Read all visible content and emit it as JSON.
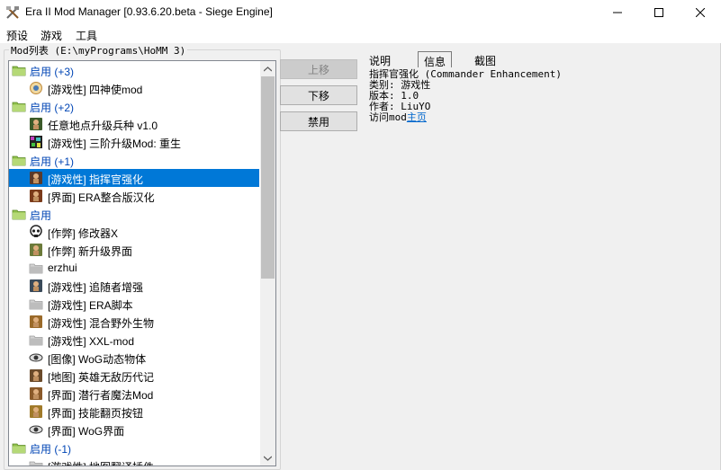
{
  "window": {
    "title": "Era II Mod Manager [0.93.6.20.beta - Siege Engine]"
  },
  "menu": {
    "items": [
      "预设",
      "游戏",
      "工具"
    ]
  },
  "modlist": {
    "label": "Mod列表 (E:\\myPrograms\\HoMM 3)",
    "rows": [
      {
        "type": "group",
        "text": "启用 (+3)",
        "icon": "folder-icon"
      },
      {
        "type": "item",
        "text": "[游戏性] 四神使mod",
        "icon": "globe-icon",
        "iconColor": "#c08a3a"
      },
      {
        "type": "group",
        "text": "启用 (+2)",
        "icon": "folder-icon"
      },
      {
        "type": "item",
        "text": "任意地点升级兵种 v1.0",
        "icon": "creature-icon",
        "iconColor": "#3b5a2a"
      },
      {
        "type": "item",
        "text": "[游戏性] 三阶升级Mod: 重生",
        "icon": "pixel-icon",
        "iconColor": "#8a3a8a"
      },
      {
        "type": "group",
        "text": "启用 (+1)",
        "icon": "folder-icon"
      },
      {
        "type": "item",
        "text": "[游戏性] 指挥官强化",
        "icon": "commander-icon",
        "iconColor": "#5a3a2a",
        "selected": true
      },
      {
        "type": "item",
        "text": "[界面] ERA整合版汉化",
        "icon": "portrait-icon",
        "iconColor": "#7a3a1a"
      },
      {
        "type": "group",
        "text": "启用",
        "icon": "folder-icon"
      },
      {
        "type": "item",
        "text": "[作弊] 修改器X",
        "icon": "skull-icon",
        "iconColor": "#222222"
      },
      {
        "type": "item",
        "text": "[作弊] 新升级界面",
        "icon": "map-icon",
        "iconColor": "#6b7a3a"
      },
      {
        "type": "item",
        "text": "erzhui",
        "icon": "blank-folder-icon",
        "iconColor": "#bdbdbd"
      },
      {
        "type": "item",
        "text": "[游戏性] 追随者增强",
        "icon": "hooded-figure-icon",
        "iconColor": "#3a4a5a"
      },
      {
        "type": "item",
        "text": "[游戏性] ERA脚本",
        "icon": "blank-folder-icon",
        "iconColor": "#bdbdbd"
      },
      {
        "type": "item",
        "text": "[游戏性] 混合野外生物",
        "icon": "creature-group-icon",
        "iconColor": "#9a6a2a"
      },
      {
        "type": "item",
        "text": "[游戏性] XXL-mod",
        "icon": "blank-folder-icon",
        "iconColor": "#bdbdbd"
      },
      {
        "type": "item",
        "text": "[图像] WoG动态物体",
        "icon": "eye-icon",
        "iconColor": "#444444"
      },
      {
        "type": "item",
        "text": "[地图] 英雄无敌历代记",
        "icon": "hero-portrait-icon",
        "iconColor": "#6a4a2a"
      },
      {
        "type": "item",
        "text": "[界面] 潜行者魔法Mod",
        "icon": "spellbook-icon",
        "iconColor": "#8a5a2a"
      },
      {
        "type": "item",
        "text": "[界面] 技能翻页按钮",
        "icon": "scroll-icon",
        "iconColor": "#a07a2a"
      },
      {
        "type": "item",
        "text": "[界面] WoG界面",
        "icon": "eye-icon",
        "iconColor": "#444444"
      },
      {
        "type": "group",
        "text": "启用 (-1)",
        "icon": "folder-icon"
      },
      {
        "type": "item",
        "text": "[游戏性] 地图翻译插件",
        "icon": "blank-folder-icon",
        "iconColor": "#bdbdbd"
      }
    ]
  },
  "buttons": {
    "up": "上移",
    "down": "下移",
    "disable": "禁用"
  },
  "tabs": {
    "description": "说明",
    "info": "信息",
    "screenshot": "截图"
  },
  "info": {
    "name": "指挥官强化 (Commander Enhancement)",
    "category": "类别: 游戏性",
    "version": "版本: 1.0",
    "author": "作者: LiuYO",
    "visit_prefix": "访问mod",
    "homepage_link": "主页"
  },
  "colors": {
    "selection": "#0078d7",
    "group_text": "#0045b5",
    "link": "#0066cc",
    "folder": "#8fbf4a"
  }
}
